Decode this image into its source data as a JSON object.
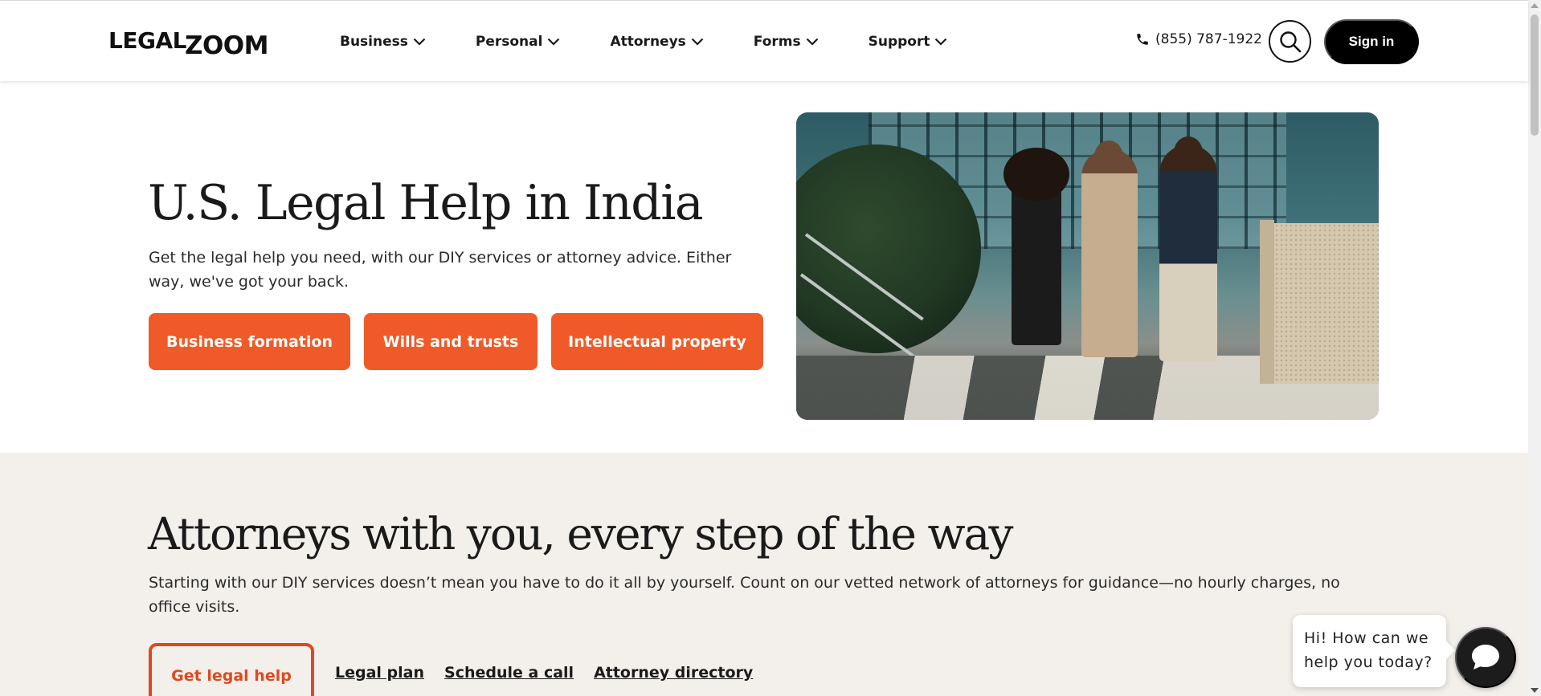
{
  "header": {
    "logo": {
      "part1": "LEGAL",
      "part2": "ZOOM"
    },
    "nav": [
      {
        "label": "Business"
      },
      {
        "label": "Personal"
      },
      {
        "label": "Attorneys"
      },
      {
        "label": "Forms"
      },
      {
        "label": "Support"
      }
    ],
    "phone": "(855) 787-1922",
    "signin_label": "Sign in"
  },
  "hero": {
    "title": "U.S. Legal Help in India",
    "description": "Get the legal help you need, with our DIY services or attorney advice. Either way, we've got your back.",
    "buttons": [
      {
        "label": "Business formation"
      },
      {
        "label": "Wills and trusts"
      },
      {
        "label": "Intellectual property"
      }
    ]
  },
  "attorneys": {
    "title": "Attorneys with you, every step of the way",
    "description": "Starting with our DIY services doesn’t mean you have to do it all by yourself. Count on our vetted network of attorneys for guidance—no hourly charges, no office visits.",
    "primary_label": "Get legal help",
    "links": [
      {
        "label": "Legal plan"
      },
      {
        "label": "Schedule a call"
      },
      {
        "label": "Attorney directory"
      }
    ]
  },
  "chat": {
    "message": "Hi! How can we help you today?"
  },
  "colors": {
    "accent": "#f05a28",
    "accent_dark": "#e0481f",
    "section_bg": "#f3f0eb",
    "dark": "#000000"
  },
  "icons": [
    "chevron-down-icon",
    "phone-icon",
    "search-icon",
    "chat-icon"
  ]
}
